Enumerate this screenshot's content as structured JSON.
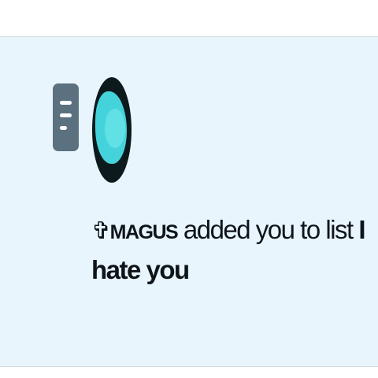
{
  "notification": {
    "icon": "list-icon",
    "avatar": "user-avatar",
    "user_symbol": "✞",
    "user_name": "MAGUS",
    "action_text": " added you to list ",
    "list_name": "I hate you"
  },
  "colors": {
    "notification_bg": "#e8f5fd",
    "icon_bg": "#5c7180",
    "avatar_accent": "#45d3db",
    "text": "#0f1419"
  }
}
